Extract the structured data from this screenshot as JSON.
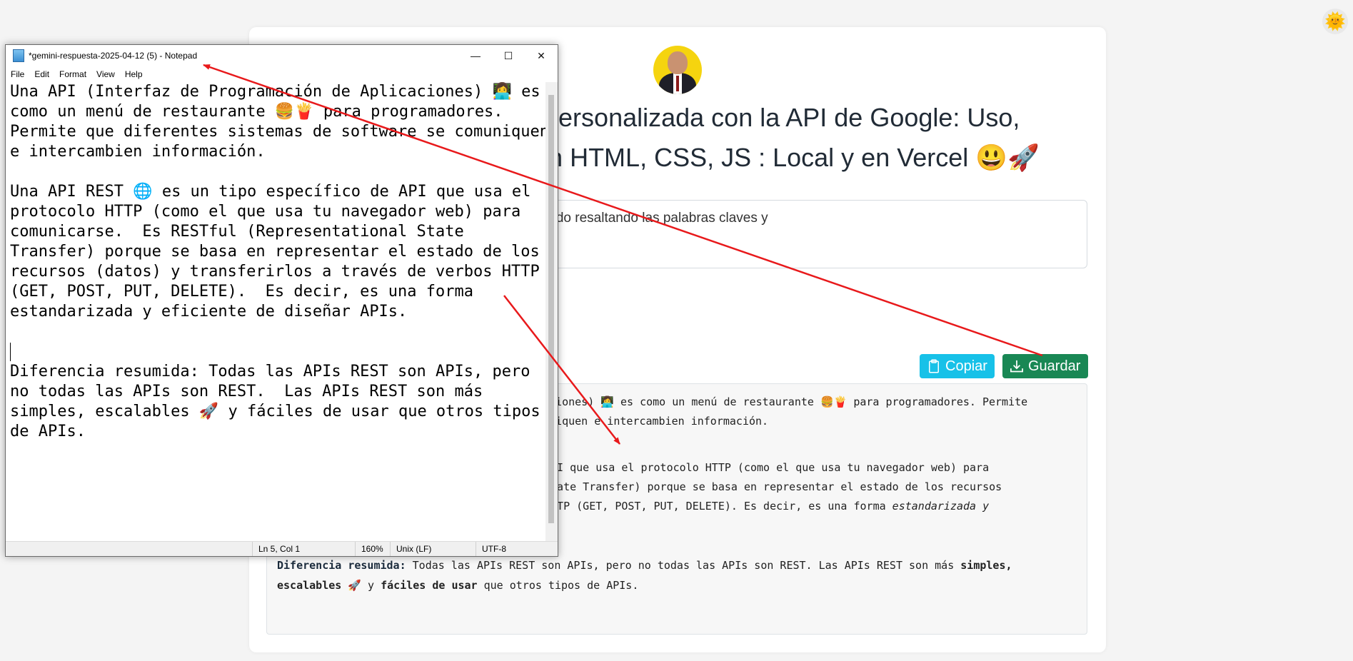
{
  "app": {
    "title_line1": "faz Personalizada con la API de Google: Uso,",
    "title_line2": "e con HTML, CSS, JS : Local y en Vercel 😃🚀",
    "prompt_text": "ferencia, de forma resumida ?, dame el resultado resaltando las palabras claves y",
    "buttons": {
      "copy": "Copiar",
      "save": "Guardar"
    },
    "theme_icon": "🌞",
    "result": {
      "p1_l1": "aciones) 👩‍💻 es como un menú de restaurante 🍔🍟 para programadores.  Permite",
      "p1_l2": "uniquen e intercambien información.",
      "p2_l1": "API que usa el protocolo HTTP (como el que usa tu navegador web) para",
      "p2_l2": " State Transfer) porque se basa en representar el estado de los recursos",
      "p2_l3_plain": " HTTP (GET, POST, PUT, DELETE).  Es decir, es una forma ",
      "p2_l3_italic": "estandarizada y",
      "p3_label": "Diferencia resumida:",
      "p3_text_a": " Todas las APIs REST son APIs, pero no todas las APIs son REST.  Las APIs REST son más ",
      "p3_bold_b": "simples,",
      "p3_l2_bold_a": "escalables",
      "p3_l2_text_a": " 🚀 y ",
      "p3_l2_bold_b": "fáciles de usar",
      "p3_l2_text_b": " que otros tipos de APIs."
    }
  },
  "notepad": {
    "title": "*gemini-respuesta-2025-04-12 (5) - Notepad",
    "menu": [
      "File",
      "Edit",
      "Format",
      "View",
      "Help"
    ],
    "lines": [
      "Una API (Interfaz de Programación de Aplicaciones) 👩‍💻 es",
      "como un menú de restaurante 🍔🍟 para programadores.",
      "Permite que diferentes sistemas de software se comuniquen",
      "e intercambien información.",
      "",
      "Una API REST 🌐 es un tipo específico de API que usa el",
      "protocolo HTTP (como el que usa tu navegador web) para",
      "comunicarse.  Es RESTful (Representational State",
      "Transfer) porque se basa en representar el estado de los",
      "recursos (datos) y transferirlos a través de verbos HTTP",
      "(GET, POST, PUT, DELETE).  Es decir, es una forma",
      "estandarizada y eficiente de diseñar APIs.",
      "",
      "",
      "Diferencia resumida: Todas las APIs REST son APIs, pero",
      "no todas las APIs son REST.  Las APIs REST son más",
      "simples, escalables 🚀 y fáciles de usar que otros tipos",
      "de APIs."
    ],
    "status": {
      "position": "Ln 5, Col 1",
      "zoom": "160%",
      "line_ending": "Unix (LF)",
      "encoding": "UTF-8"
    },
    "controls": {
      "minimize": "—",
      "maximize": "☐",
      "close": "✕"
    }
  },
  "colors": {
    "arrow": "#e8191b",
    "copy_button": "#17c1e8",
    "save_button": "#198754"
  }
}
